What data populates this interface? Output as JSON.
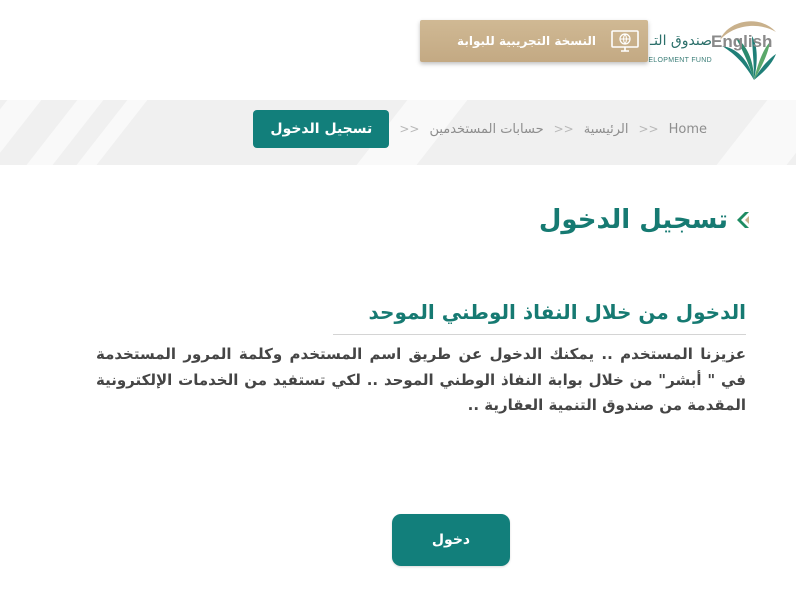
{
  "header": {
    "english_link": "English",
    "logo": {
      "name_ar": "صندوق التـ",
      "name_en": "REAL ESTATE DEVELOPMENT FUND",
      "icon": "logo-emblem-icon"
    },
    "beta_banner": {
      "label": "النسخة التجريبية للبوابة",
      "icon": "computer-globe-icon"
    }
  },
  "breadcrumb": {
    "items": [
      {
        "label": "Home"
      },
      {
        "label": "الرئيسية"
      },
      {
        "label": "حسابات المستخدمين"
      }
    ],
    "separator": ">>",
    "current": "تسجيل الدخول"
  },
  "main": {
    "title_icon": "chevron-left-icon",
    "title": "تسجيل الدخول",
    "section_title": "الدخول من خلال النفاذ الوطني الموحد",
    "description": "عزيزنا المستخدم .. يمكنك الدخول عن طريق اسم المستخدم وكلمة المرور المستخدمة في \" أبشر\" من خلال بوابة النفاذ الوطني الموحد .. لكي تستفيد من الخدمات الإلكترونية المقدمة من صندوق التنمية العقارية ..",
    "login_button": "دخول"
  },
  "colors": {
    "primary": "#127f7b",
    "title": "#167a72",
    "banner": "#c9b18c",
    "breadcrumb_bg": "#f0f0f0",
    "body_text": "#454545"
  }
}
